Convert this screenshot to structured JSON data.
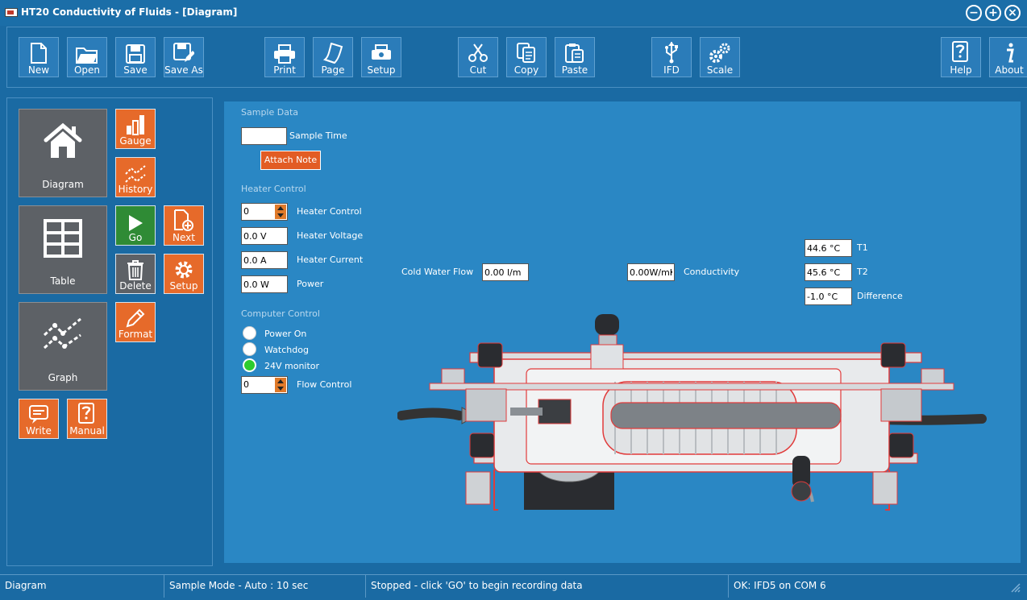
{
  "window": {
    "title": "HT20 Conductivity of Fluids - [Diagram]"
  },
  "toolbar": {
    "new": "New",
    "open": "Open",
    "save": "Save",
    "save_as": "Save As",
    "print": "Print",
    "page": "Page",
    "setup": "Setup",
    "cut": "Cut",
    "copy": "Copy",
    "paste": "Paste",
    "ifd": "IFD",
    "scale": "Scale",
    "help": "Help",
    "about": "About"
  },
  "nav": {
    "diagram": "Diagram",
    "table": "Table",
    "graph": "Graph",
    "gauge": "Gauge",
    "history": "History",
    "go": "Go",
    "next": "Next",
    "delete": "Delete",
    "setup": "Setup",
    "format": "Format",
    "write": "Write",
    "manual": "Manual"
  },
  "sample": {
    "heading": "Sample Data",
    "time_label": "Sample Time",
    "time_value": "",
    "attach_note": "Attach Note"
  },
  "heater": {
    "heading": "Heater Control",
    "control_label": "Heater Control",
    "control_value": "0",
    "voltage_label": "Heater Voltage",
    "voltage_value": "0.0 V",
    "current_label": "Heater Current",
    "current_value": "0.0 A",
    "power_label": "Power",
    "power_value": "0.0 W"
  },
  "computer": {
    "heading": "Computer Control",
    "power_on": "Power On",
    "watchdog": "Watchdog",
    "monitor": "24V monitor",
    "flow_label": "Flow Control",
    "flow_value": "0"
  },
  "measure": {
    "cold_flow_label": "Cold Water Flow",
    "cold_flow_value": "0.00 l/m",
    "conductivity_label": "Conductivity",
    "conductivity_value": "0.00W/mK",
    "t1_label": "T1",
    "t1_value": "44.6 °C",
    "t2_label": "T2",
    "t2_value": "45.6 °C",
    "diff_label": "Difference",
    "diff_value": "-1.0 °C"
  },
  "status": {
    "view": "Diagram",
    "mode": "Sample Mode - Auto : 10 sec",
    "state": "Stopped - click 'GO' to begin recording data",
    "connection": "OK: IFD5 on COM 6"
  }
}
